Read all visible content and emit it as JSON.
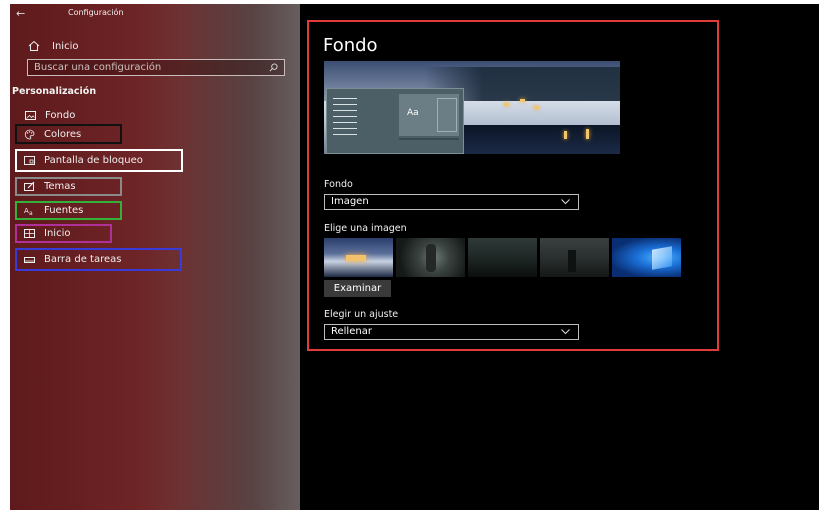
{
  "window": {
    "back_glyph": "←",
    "title": "Configuración"
  },
  "sidebar": {
    "home_label": "Inicio",
    "search_placeholder": "Buscar una configuración",
    "section_label": "Personalización",
    "items": [
      {
        "label": "Fondo",
        "icon": "picture-icon",
        "border_color": ""
      },
      {
        "label": "Colores",
        "icon": "palette-icon",
        "border_color": "#111111"
      },
      {
        "label": "Pantalla de bloqueo",
        "icon": "lock-screen-icon",
        "border_color": "#ffffff"
      },
      {
        "label": "Temas",
        "icon": "brush-icon",
        "border_color": "#8a8a8a"
      },
      {
        "label": "Fuentes",
        "icon": "font-icon",
        "border_color": "#35b03a"
      },
      {
        "label": "Inicio",
        "icon": "start-icon",
        "border_color": "#b0309a"
      },
      {
        "label": "Barra de tareas",
        "icon": "taskbar-icon",
        "border_color": "#3a3ad8"
      }
    ]
  },
  "main": {
    "title": "Fondo",
    "preview_sample": "Aa",
    "background_label": "Fondo",
    "background_value": "Imagen",
    "choose_image_label": "Elige una imagen",
    "browse_label": "Examinar",
    "fit_label": "Elegir un ajuste",
    "fit_value": "Rellenar",
    "frame_color": "#e23b3b"
  }
}
